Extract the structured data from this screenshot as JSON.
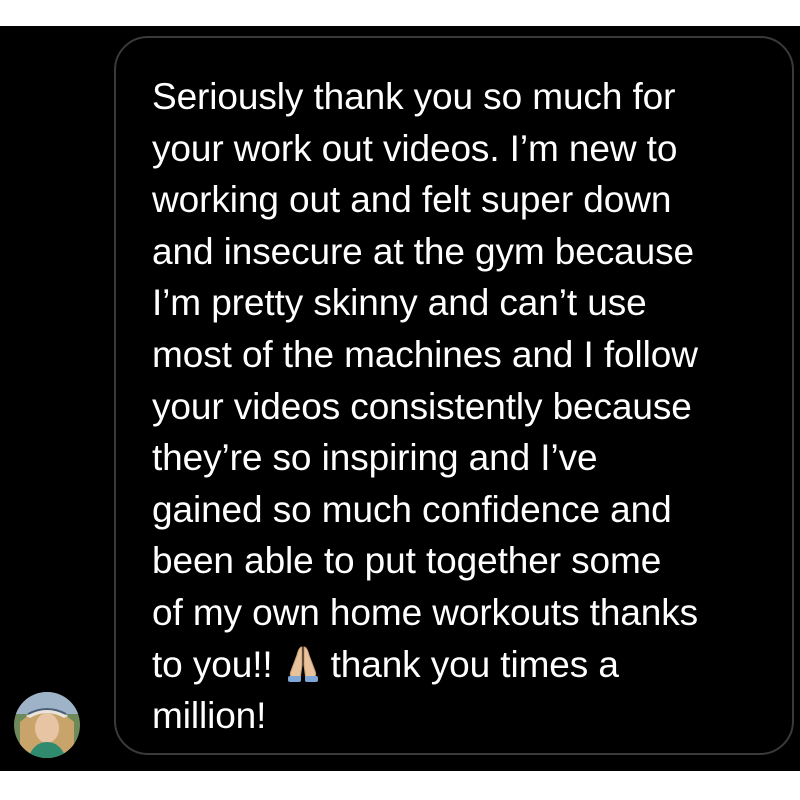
{
  "conversation": {
    "avatar_icon": "user-avatar-icon",
    "message": {
      "lines": [
        "Seriously thank you so much for",
        "your work out videos. I’m new to",
        "working out and felt super down",
        "and insecure at the gym because",
        "I’m pretty skinny and can’t use",
        "most of the machines and I follow",
        "your videos consistently because",
        "they’re so inspiring and I’ve",
        "gained so much confidence and",
        "been able to put together some",
        "of my own home workouts thanks"
      ],
      "line12_before_emoji": "to you!!",
      "emoji_icon": "folded-hands-emoji",
      "line12_after_emoji": "thank you times a",
      "line13": "million!"
    }
  },
  "colors": {
    "background": "#000000",
    "page": "#ffffff",
    "bubble_border": "#3a3a3c",
    "text": "#ffffff",
    "emoji": "#e8c39e"
  }
}
